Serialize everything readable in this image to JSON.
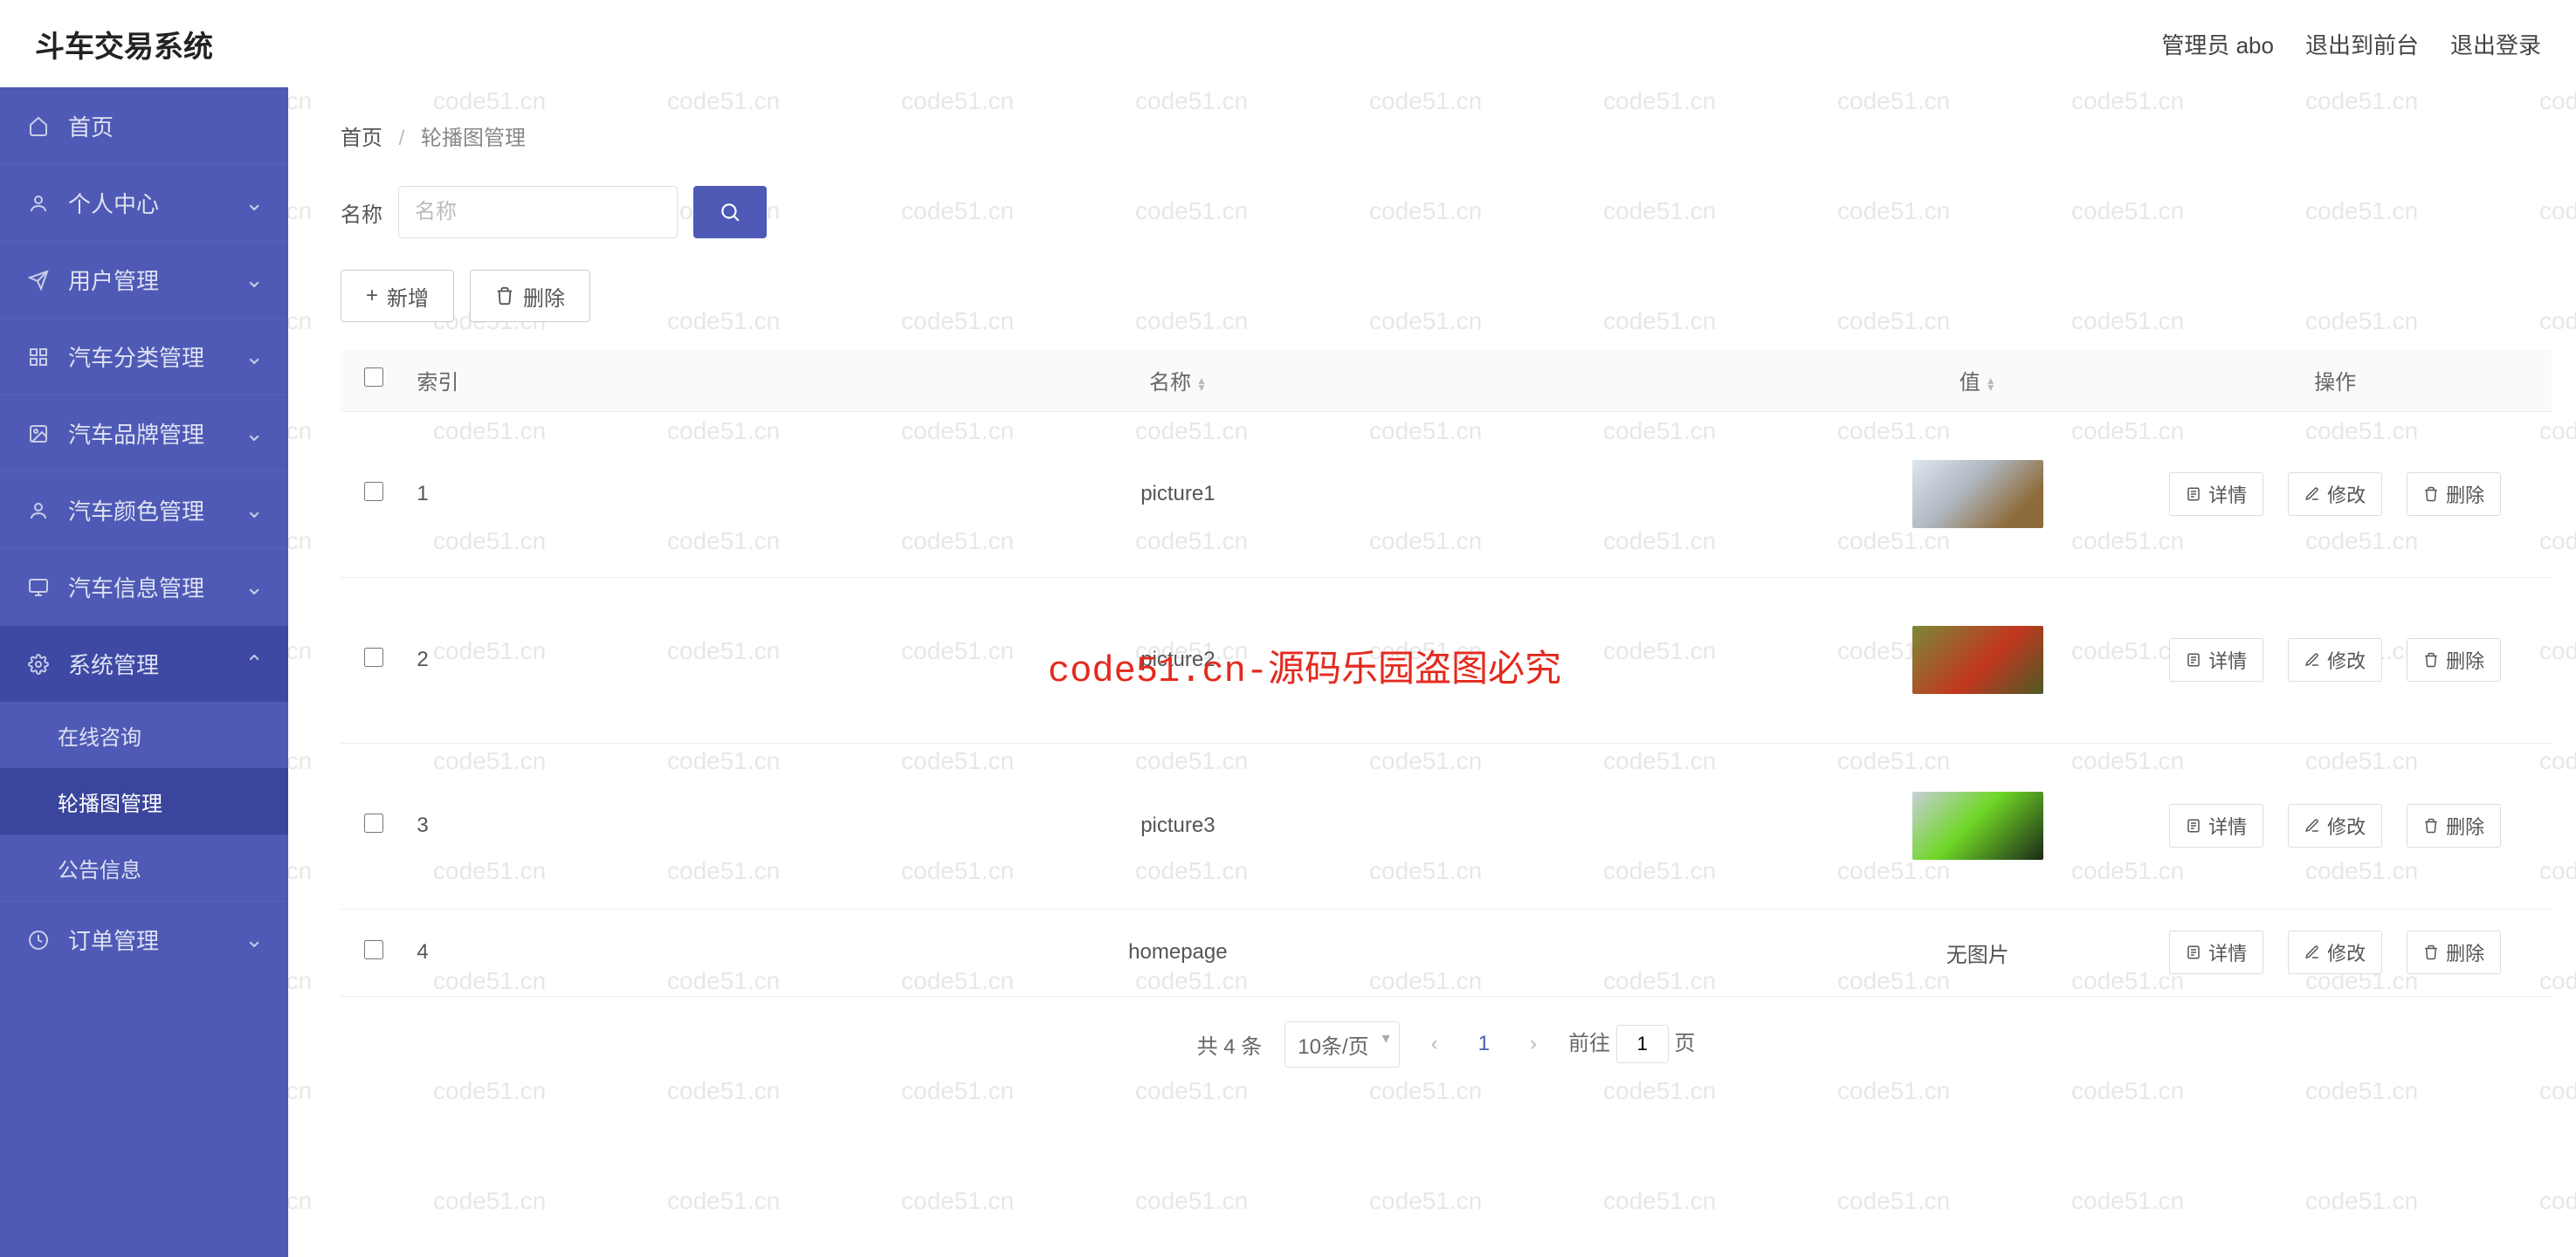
{
  "header": {
    "title": "斗车交易系统",
    "admin_label": "管理员 abo",
    "logout_front": "退出到前台",
    "logout": "退出登录"
  },
  "sidebar": {
    "items": [
      {
        "label": "首页",
        "icon": "home"
      },
      {
        "label": "个人中心",
        "icon": "user"
      },
      {
        "label": "用户管理",
        "icon": "send"
      },
      {
        "label": "汽车分类管理",
        "icon": "grid"
      },
      {
        "label": "汽车品牌管理",
        "icon": "image"
      },
      {
        "label": "汽车颜色管理",
        "icon": "user"
      },
      {
        "label": "汽车信息管理",
        "icon": "monitor"
      },
      {
        "label": "系统管理",
        "icon": "gear",
        "expanded": true
      },
      {
        "label": "订单管理",
        "icon": "clock"
      }
    ],
    "system_children": [
      {
        "label": "在线咨询"
      },
      {
        "label": "轮播图管理",
        "current": true
      },
      {
        "label": "公告信息"
      }
    ]
  },
  "breadcrumb": {
    "home": "首页",
    "current": "轮播图管理"
  },
  "filter": {
    "name_label": "名称",
    "name_placeholder": "名称"
  },
  "actions": {
    "add": "新增",
    "delete": "删除"
  },
  "table": {
    "headers": {
      "index": "索引",
      "name": "名称",
      "value": "值",
      "ops": "操作"
    },
    "rows": [
      {
        "index": "1",
        "name": "picture1",
        "value_type": "img",
        "img_class": "t1"
      },
      {
        "index": "2",
        "name": "picture2",
        "value_type": "img",
        "img_class": "t2"
      },
      {
        "index": "3",
        "name": "picture3",
        "value_type": "img",
        "img_class": "t3"
      },
      {
        "index": "4",
        "name": "homepage",
        "value_type": "none",
        "none_text": "无图片"
      }
    ],
    "op_labels": {
      "detail": "详情",
      "edit": "修改",
      "delete": "删除"
    }
  },
  "pagination": {
    "total_text": "共 4 条",
    "page_size": "10条/页",
    "current": "1",
    "goto_label": "前往",
    "goto_value": "1",
    "goto_suffix": "页"
  },
  "overlay": "code51.cn-源码乐园盗图必究",
  "watermark": "code51.cn",
  "colors": {
    "primary": "#4e5ab5"
  }
}
